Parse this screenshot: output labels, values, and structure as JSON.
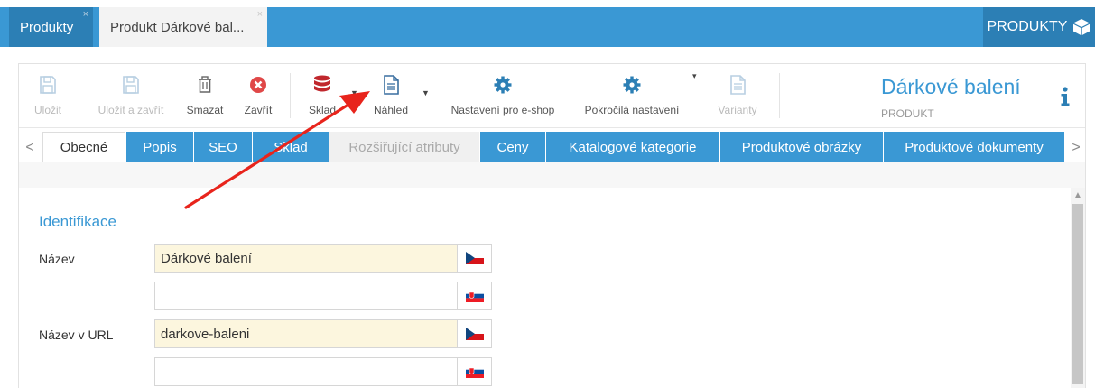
{
  "top_tabs": [
    {
      "label": "Produkty"
    },
    {
      "label": "Produkt Dárkové bal..."
    }
  ],
  "tab_close_glyph": "×",
  "module": {
    "title": "PRODUKTY",
    "icon": "cube-icon"
  },
  "toolbar": {
    "save": "Uložit",
    "save_close": "Uložit a zavřít",
    "delete": "Smazat",
    "close": "Zavřít",
    "stock": "Sklad",
    "preview": "Náhled",
    "eshop_settings": "Nastavení pro e-shop",
    "advanced_settings": "Pokročilá nastavení",
    "variants": "Varianty"
  },
  "product": {
    "title": "Dárkové balení",
    "subtitle": "PRODUKT"
  },
  "section_tabs": [
    "Obecné",
    "Popis",
    "SEO",
    "Sklad",
    "Rozšiřující atributy",
    "Ceny",
    "Katalogové kategorie",
    "Produktové obrázky",
    "Produktové dokumenty"
  ],
  "nav": {
    "prev": "<",
    "next": ">"
  },
  "form": {
    "section_title": "Identifikace",
    "name_label": "Název",
    "name_cz": "Dárkové balení",
    "name_sk": "",
    "url_label": "Název v URL",
    "url_cz": "darkove-baleni",
    "url_sk": ""
  },
  "colors": {
    "accent": "#3a98d4",
    "accent_dark": "#2c7fb5",
    "highlight": "#fcf6de",
    "annotation": "#e8241c"
  }
}
